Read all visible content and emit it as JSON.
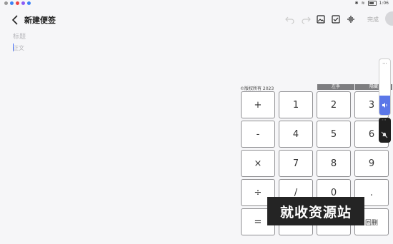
{
  "status": {
    "time": "1:06",
    "status_colors": [
      "#3b82f6",
      "#ef4444",
      "#8b5cf6",
      "#3b82f6"
    ]
  },
  "header": {
    "title": "新建便签",
    "done_label": "完成"
  },
  "editor": {
    "title_placeholder": "标题",
    "body_placeholder": "正文"
  },
  "calculator": {
    "copyright": "©版权所有 2023",
    "tab_left_hand": "左手",
    "tab_hide": "隐藏",
    "keys": [
      [
        "+",
        "1",
        "2",
        "3"
      ],
      [
        "-",
        "4",
        "5",
        "6"
      ],
      [
        "×",
        "7",
        "8",
        "9"
      ],
      [
        "÷",
        "/",
        "0",
        "."
      ],
      [
        "=",
        "",
        "",
        "回删"
      ]
    ]
  },
  "watermark": "就收资源站",
  "colors": {
    "accent": "#5b77e8",
    "caret": "#3f6bff"
  }
}
